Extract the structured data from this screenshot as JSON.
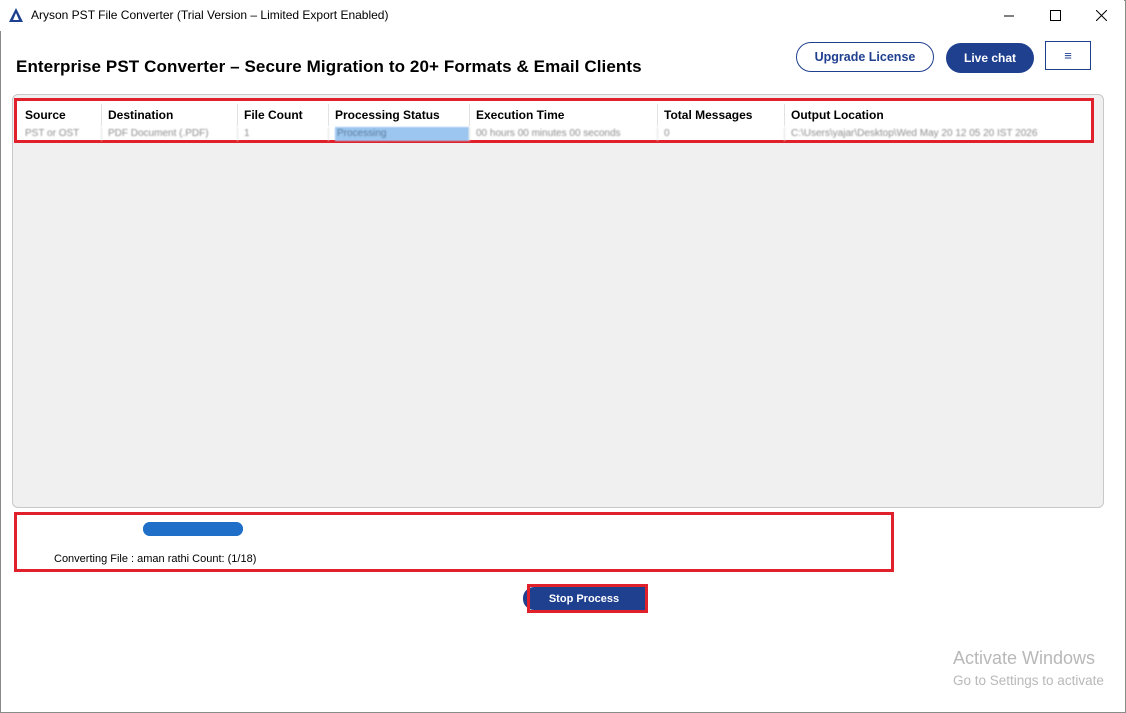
{
  "window": {
    "title": "Aryson PST File Converter (Trial Version – Limited Export Enabled)",
    "icon": "aryson-logo-icon"
  },
  "header": {
    "page_title": "Enterprise PST Converter – Secure Migration to 20+ Formats & Email Clients",
    "upgrade_label": "Upgrade License",
    "livechat_label": "Live chat",
    "menu_icon": "≡"
  },
  "grid": {
    "columns": [
      "Source",
      "Destination",
      "File Count",
      "Processing Status",
      "Execution Time",
      "Total Messages",
      "Output Location"
    ],
    "rows": [
      [
        "PST or OST",
        "PDF Document (.PDF)",
        "1",
        "Processing",
        "00 hours 00 minutes 00 seconds",
        "0",
        "C:\\Users\\yajar\\Desktop\\Wed May 20 12 05 20 IST 2026"
      ]
    ]
  },
  "progress": {
    "fraction": 1.0,
    "status_text": "Converting File : aman rathi Count: (1/18)"
  },
  "actions": {
    "stop_label": "Stop Process"
  },
  "watermark": {
    "title": "Activate Windows",
    "subtitle": "Go to Settings to activate"
  },
  "colors": {
    "brand": "#1f3f8f",
    "highlight": "#e0202a",
    "progress": "#1f6fc8"
  }
}
